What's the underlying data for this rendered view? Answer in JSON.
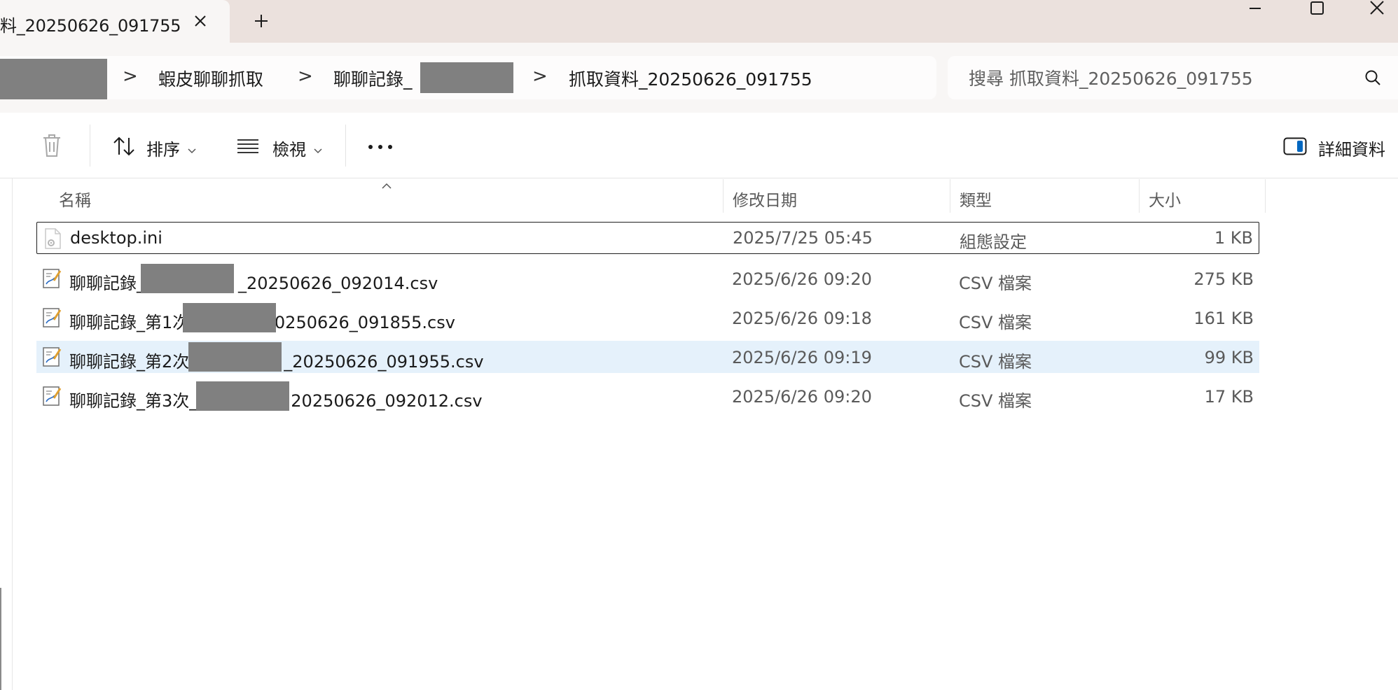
{
  "window": {
    "tab_title": "料_20250626_091755",
    "icons": {
      "tab_close": "close-icon",
      "new_tab": "plus-icon",
      "minimize": "minimize-icon",
      "maximize": "maximize-icon",
      "close": "close-icon"
    }
  },
  "breadcrumb": {
    "items": [
      "蝦皮聊聊抓取",
      "聊聊記錄_",
      "抓取資料_20250626_091755"
    ],
    "separator": ">",
    "redacted_color": "#808080"
  },
  "search": {
    "placeholder": "搜尋 抓取資料_20250626_091755",
    "icon": "search-icon"
  },
  "toolbar": {
    "sort_label": "排序",
    "view_label": "檢視",
    "details_label": "詳細資料",
    "icons": {
      "delete": "trash-icon",
      "sort": "sort-icon",
      "view": "list-view-icon",
      "more": "more-icon",
      "details": "details-pane-icon"
    }
  },
  "columns": {
    "name": "名稱",
    "date": "修改日期",
    "type": "類型",
    "size": "大小"
  },
  "files": [
    {
      "name": "desktop.ini",
      "date": "2025/7/25 05:45",
      "type": "組態設定",
      "size": "1 KB",
      "icon": "settings-file-icon",
      "state": "focused"
    },
    {
      "name_pre": "聊聊記錄_",
      "name_post": "_20250626_092014.csv",
      "date": "2025/6/26 09:20",
      "type": "CSV 檔案",
      "size": "275 KB",
      "icon": "csv-file-icon"
    },
    {
      "name_pre": "聊聊記錄_第1次",
      "name_post": ")_20250626_091855.csv",
      "date": "2025/6/26 09:18",
      "type": "CSV 檔案",
      "size": "161 KB",
      "icon": "csv-file-icon"
    },
    {
      "name_pre": "聊聊記錄_第2次",
      "name_post": "_20250626_091955.csv",
      "date": "2025/6/26 09:19",
      "type": "CSV 檔案",
      "size": "99 KB",
      "icon": "csv-file-icon",
      "state": "selected"
    },
    {
      "name_pre": "聊聊記錄_第3次_",
      "name_post": "20250626_092012.csv",
      "date": "2025/6/26 09:20",
      "type": "CSV 檔案",
      "size": "17 KB",
      "icon": "csv-file-icon"
    }
  ],
  "colors": {
    "title_bar": "#ebe1dd",
    "toolbar_bg": "#f8f6f5",
    "selection": "#e5f1fb",
    "redaction": "#808080"
  }
}
